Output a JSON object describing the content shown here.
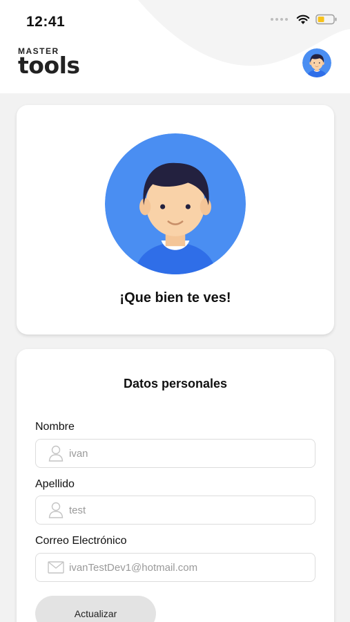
{
  "status_bar": {
    "time": "12:41"
  },
  "logo": {
    "top": "MASTER",
    "main": "tools"
  },
  "profile": {
    "greeting": "¡Que bien te ves!"
  },
  "form": {
    "title": "Datos personales",
    "nombre": {
      "label": "Nombre",
      "value": "ivan"
    },
    "apellido": {
      "label": "Apellido",
      "value": "test"
    },
    "correo": {
      "label": "Correo Electrónico",
      "value": "ivanTestDev1@hotmail.com"
    },
    "submit_label": "Actualizar"
  },
  "icons": {
    "wifi": "wifi-icon",
    "battery": "battery-icon",
    "user": "user-icon",
    "mail": "mail-icon"
  },
  "colors": {
    "avatar_bg": "#4a8ef2",
    "hair": "#23213f",
    "skin": "#f9d2a8",
    "shirt": "#2f6ee8",
    "battery": "#f7c21b",
    "button_bg": "#e3e3e3"
  }
}
